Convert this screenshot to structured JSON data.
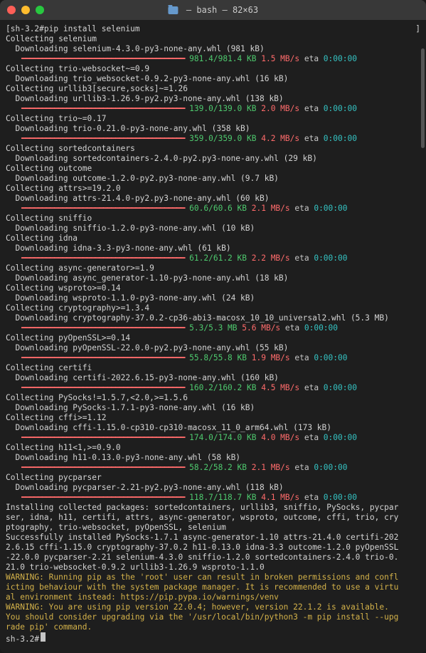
{
  "title_bar": {
    "folder_name": "",
    "title_suffix": " — bash — 82×63"
  },
  "prompt": "sh-3.2# ",
  "final_prompt": "sh-3.2# ",
  "command": "pip install selenium",
  "lines": [
    {
      "t": "plain",
      "text": "Collecting selenium"
    },
    {
      "t": "plain",
      "text": "  Downloading selenium-4.3.0-py3-none-any.whl (981 kB)"
    },
    {
      "t": "progress",
      "size": "981.4/981.4 KB",
      "speed": "1.5 MB/s",
      "eta": "0:00:00"
    },
    {
      "t": "plain",
      "text": "Collecting trio-websocket~=0.9"
    },
    {
      "t": "plain",
      "text": "  Downloading trio_websocket-0.9.2-py3-none-any.whl (16 kB)"
    },
    {
      "t": "plain",
      "text": "Collecting urllib3[secure,socks]~=1.26"
    },
    {
      "t": "plain",
      "text": "  Downloading urllib3-1.26.9-py2.py3-none-any.whl (138 kB)"
    },
    {
      "t": "progress",
      "size": "139.0/139.0 KB",
      "speed": "2.0 MB/s",
      "eta": "0:00:00"
    },
    {
      "t": "plain",
      "text": "Collecting trio~=0.17"
    },
    {
      "t": "plain",
      "text": "  Downloading trio-0.21.0-py3-none-any.whl (358 kB)"
    },
    {
      "t": "progress",
      "size": "359.0/359.0 KB",
      "speed": "4.2 MB/s",
      "eta": "0:00:00"
    },
    {
      "t": "plain",
      "text": "Collecting sortedcontainers"
    },
    {
      "t": "plain",
      "text": "  Downloading sortedcontainers-2.4.0-py2.py3-none-any.whl (29 kB)"
    },
    {
      "t": "plain",
      "text": "Collecting outcome"
    },
    {
      "t": "plain",
      "text": "  Downloading outcome-1.2.0-py2.py3-none-any.whl (9.7 kB)"
    },
    {
      "t": "plain",
      "text": "Collecting attrs>=19.2.0"
    },
    {
      "t": "plain",
      "text": "  Downloading attrs-21.4.0-py2.py3-none-any.whl (60 kB)"
    },
    {
      "t": "progress",
      "size": "60.6/60.6 KB",
      "speed": "2.1 MB/s",
      "eta": "0:00:00"
    },
    {
      "t": "plain",
      "text": "Collecting sniffio"
    },
    {
      "t": "plain",
      "text": "  Downloading sniffio-1.2.0-py3-none-any.whl (10 kB)"
    },
    {
      "t": "plain",
      "text": "Collecting idna"
    },
    {
      "t": "plain",
      "text": "  Downloading idna-3.3-py3-none-any.whl (61 kB)"
    },
    {
      "t": "progress",
      "size": "61.2/61.2 KB",
      "speed": "2.2 MB/s",
      "eta": "0:00:00"
    },
    {
      "t": "plain",
      "text": "Collecting async-generator>=1.9"
    },
    {
      "t": "plain",
      "text": "  Downloading async_generator-1.10-py3-none-any.whl (18 kB)"
    },
    {
      "t": "plain",
      "text": "Collecting wsproto>=0.14"
    },
    {
      "t": "plain",
      "text": "  Downloading wsproto-1.1.0-py3-none-any.whl (24 kB)"
    },
    {
      "t": "plain",
      "text": "Collecting cryptography>=1.3.4"
    },
    {
      "t": "plain",
      "text": "  Downloading cryptography-37.0.2-cp36-abi3-macosx_10_10_universal2.whl (5.3 MB)"
    },
    {
      "t": "progress",
      "size": "5.3/5.3 MB",
      "speed": "5.6 MB/s",
      "eta": "0:00:00"
    },
    {
      "t": "plain",
      "text": "Collecting pyOpenSSL>=0.14"
    },
    {
      "t": "plain",
      "text": "  Downloading pyOpenSSL-22.0.0-py2.py3-none-any.whl (55 kB)"
    },
    {
      "t": "progress",
      "size": "55.8/55.8 KB",
      "speed": "1.9 MB/s",
      "eta": "0:00:00"
    },
    {
      "t": "plain",
      "text": "Collecting certifi"
    },
    {
      "t": "plain",
      "text": "  Downloading certifi-2022.6.15-py3-none-any.whl (160 kB)"
    },
    {
      "t": "progress",
      "size": "160.2/160.2 KB",
      "speed": "4.5 MB/s",
      "eta": "0:00:00"
    },
    {
      "t": "plain",
      "text": "Collecting PySocks!=1.5.7,<2.0,>=1.5.6"
    },
    {
      "t": "plain",
      "text": "  Downloading PySocks-1.7.1-py3-none-any.whl (16 kB)"
    },
    {
      "t": "plain",
      "text": "Collecting cffi>=1.12"
    },
    {
      "t": "plain",
      "text": "  Downloading cffi-1.15.0-cp310-cp310-macosx_11_0_arm64.whl (173 kB)"
    },
    {
      "t": "progress",
      "size": "174.0/174.0 KB",
      "speed": "4.0 MB/s",
      "eta": "0:00:00"
    },
    {
      "t": "plain",
      "text": "Collecting h11<1,>=0.9.0"
    },
    {
      "t": "plain",
      "text": "  Downloading h11-0.13.0-py3-none-any.whl (58 kB)"
    },
    {
      "t": "progress",
      "size": "58.2/58.2 KB",
      "speed": "2.1 MB/s",
      "eta": "0:00:00"
    },
    {
      "t": "plain",
      "text": "Collecting pycparser"
    },
    {
      "t": "plain",
      "text": "  Downloading pycparser-2.21-py2.py3-none-any.whl (118 kB)"
    },
    {
      "t": "progress",
      "size": "118.7/118.7 KB",
      "speed": "4.1 MB/s",
      "eta": "0:00:00"
    },
    {
      "t": "wrap",
      "text": "Installing collected packages: sortedcontainers, urllib3, sniffio, PySocks, pycparser, idna, h11, certifi, attrs, async-generator, wsproto, outcome, cffi, trio, cryptography, trio-websocket, pyOpenSSL, selenium"
    },
    {
      "t": "wrap",
      "text": "Successfully installed PySocks-1.7.1 async-generator-1.10 attrs-21.4.0 certifi-2022.6.15 cffi-1.15.0 cryptography-37.0.2 h11-0.13.0 idna-3.3 outcome-1.2.0 pyOpenSSL-22.0.0 pycparser-2.21 selenium-4.3.0 sniffio-1.2.0 sortedcontainers-2.4.0 trio-0.21.0 trio-websocket-0.9.2 urllib3-1.26.9 wsproto-1.1.0"
    },
    {
      "t": "warn",
      "text": "WARNING: Running pip as the 'root' user can result in broken permissions and conflicting behaviour with the system package manager. It is recommended to use a virtual environment instead: https://pip.pypa.io/warnings/venv"
    },
    {
      "t": "warn",
      "text": "WARNING: You are using pip version 22.0.4; however, version 22.1.2 is available."
    },
    {
      "t": "warn",
      "text": "You should consider upgrading via the '/usr/local/bin/python3 -m pip install --upgrade pip' command."
    }
  ]
}
